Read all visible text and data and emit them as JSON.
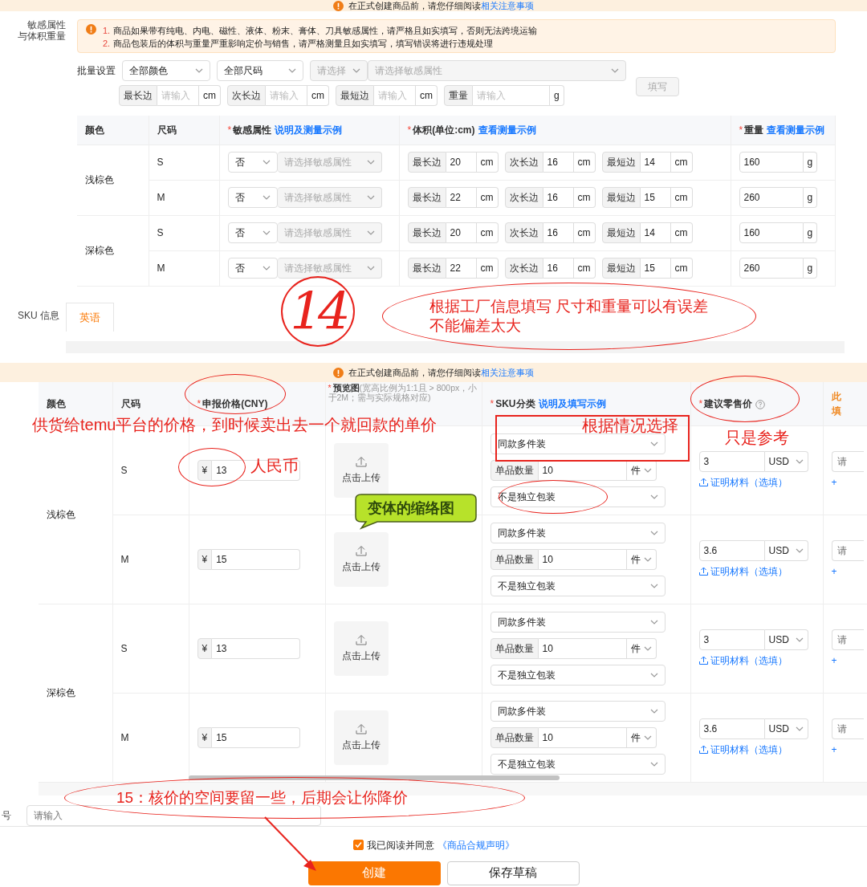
{
  "top_notice": {
    "text": "在正式创建商品前，请您仔细阅读",
    "link": "相关注意事项"
  },
  "spec_section": {
    "label_lines": [
      "敏感属性",
      "与体积重量"
    ],
    "warnings": [
      {
        "number": "1.",
        "text": "商品如果带有纯电、内电、磁性、液体、粉末、膏体、刀具敏感属性，请严格且如实填写，否则无法跨境运输"
      },
      {
        "number": "2.",
        "text": "商品包装后的体积与重量严重影响定价与销售，请严格测量且如实填写，填写错误将进行违规处理"
      }
    ],
    "batch": {
      "label": "批量设置",
      "selects": [
        {
          "text": "全部颜色",
          "disabled": false
        },
        {
          "text": "全部尺码",
          "disabled": false
        },
        {
          "text": "请选择",
          "disabled": true
        },
        {
          "text": "请选择敏感属性",
          "disabled": true
        }
      ],
      "fields": [
        {
          "label": "最长边",
          "placeholder": "请输入",
          "unit": "cm"
        },
        {
          "label": "次长边",
          "placeholder": "请输入",
          "unit": "cm"
        },
        {
          "label": "最短边",
          "placeholder": "请输入",
          "unit": "cm"
        },
        {
          "label": "重量",
          "placeholder": "请输入",
          "unit": "g"
        }
      ],
      "button": {
        "label": "填写",
        "disabled": true
      }
    },
    "table": {
      "columns": [
        {
          "label": "颜色"
        },
        {
          "label": "尺码"
        },
        {
          "mark": "*",
          "label": "敏感属性",
          "link": "说明及测量示例"
        },
        {
          "mark": "*",
          "label": "体积(单位:cm)",
          "link": "查看测量示例"
        },
        {
          "mark": "*",
          "label": "重量",
          "link": "查看测量示例"
        }
      ],
      "groups": [
        {
          "color_name": "浅棕色",
          "rows": [
            {
              "size": "S",
              "sensitive": "否",
              "sensitive_detail": "请选择敏感属性",
              "dims": [
                {
                  "label": "最长边",
                  "value": "20",
                  "unit": "cm"
                },
                {
                  "label": "次长边",
                  "value": "16",
                  "unit": "cm"
                },
                {
                  "label": "最短边",
                  "value": "14",
                  "unit": "cm"
                }
              ],
              "weight": "160",
              "weight_unit": "g"
            },
            {
              "size": "M",
              "sensitive": "否",
              "sensitive_detail": "请选择敏感属性",
              "dims": [
                {
                  "label": "最长边",
                  "value": "22",
                  "unit": "cm"
                },
                {
                  "label": "次长边",
                  "value": "16",
                  "unit": "cm"
                },
                {
                  "label": "最短边",
                  "value": "15",
                  "unit": "cm"
                }
              ],
              "weight": "260",
              "weight_unit": "g"
            }
          ]
        },
        {
          "color_name": "深棕色",
          "rows": [
            {
              "size": "S",
              "sensitive": "否",
              "sensitive_detail": "请选择敏感属性",
              "dims": [
                {
                  "label": "最长边",
                  "value": "20",
                  "unit": "cm"
                },
                {
                  "label": "次长边",
                  "value": "16",
                  "unit": "cm"
                },
                {
                  "label": "最短边",
                  "value": "14",
                  "unit": "cm"
                }
              ],
              "weight": "160",
              "weight_unit": "g"
            },
            {
              "size": "M",
              "sensitive": "否",
              "sensitive_detail": "请选择敏感属性",
              "dims": [
                {
                  "label": "最长边",
                  "value": "22",
                  "unit": "cm"
                },
                {
                  "label": "次长边",
                  "value": "16",
                  "unit": "cm"
                },
                {
                  "label": "最短边",
                  "value": "15",
                  "unit": "cm"
                }
              ],
              "weight": "260",
              "weight_unit": "g"
            }
          ]
        }
      ]
    }
  },
  "sku_info": {
    "label": "SKU 信息",
    "tabs": [
      {
        "label": "英语",
        "selected": true
      }
    ]
  },
  "second_notice": {
    "text": "在正式创建商品前，请您仔细阅读",
    "link": "相关注意事项"
  },
  "sku_table": {
    "columns": [
      {
        "label": "颜色"
      },
      {
        "label": "尺码"
      },
      {
        "mark": "*",
        "label": "申报价格(CNY)"
      },
      {
        "mark": "*",
        "label": "预览图",
        "hint": "(宽高比例为1:1且 > 800px，小于2M；需与实际规格对应)"
      },
      {
        "mark": "*",
        "label": "SKU分类",
        "link": "说明及填写示例"
      },
      {
        "mark": "*",
        "label": "建议零售价",
        "help": true
      },
      {
        "lines": [
          "此",
          "填"
        ]
      }
    ],
    "groups": [
      {
        "color_name": "浅棕色",
        "rows": [
          {
            "size": "S",
            "currency": "¥",
            "price": "13",
            "upload": "点击上传",
            "category": "同款多件装",
            "qty_label": "单品数量",
            "qty": "10",
            "qty_unit": "件",
            "packaging": "不是独立包装",
            "retail": "3",
            "retail_currency": "USD",
            "proof_link": "证明材料（选填）",
            "extra_placeholder": "请",
            "extra_link": "+"
          },
          {
            "size": "M",
            "currency": "¥",
            "price": "15",
            "upload": "点击上传",
            "category": "同款多件装",
            "qty_label": "单品数量",
            "qty": "10",
            "qty_unit": "件",
            "packaging": "不是独立包装",
            "retail": "3.6",
            "retail_currency": "USD",
            "proof_link": "证明材料（选填）",
            "extra_placeholder": "请",
            "extra_link": "+"
          }
        ]
      },
      {
        "color_name": "深棕色",
        "rows": [
          {
            "size": "S",
            "currency": "¥",
            "price": "13",
            "upload": "点击上传",
            "category": "同款多件装",
            "qty_label": "单品数量",
            "qty": "10",
            "qty_unit": "件",
            "packaging": "不是独立包装",
            "retail": "3",
            "retail_currency": "USD",
            "proof_link": "证明材料（选填）",
            "extra_placeholder": "请",
            "extra_link": "+"
          },
          {
            "size": "M",
            "currency": "¥",
            "price": "15",
            "upload": "点击上传",
            "category": "同款多件装",
            "qty_label": "单品数量",
            "qty": "10",
            "qty_unit": "件",
            "packaging": "不是独立包装",
            "retail": "3.6",
            "retail_currency": "USD",
            "proof_link": "证明材料（选填）",
            "extra_placeholder": "请",
            "extra_link": "+"
          }
        ]
      }
    ]
  },
  "item_no": {
    "label": "号",
    "placeholder": "请输入"
  },
  "agreement": {
    "checked": true,
    "text": "我已阅读并同意",
    "link": "《商品合规声明》"
  },
  "buttons": [
    {
      "label": "创建",
      "kind": "primary"
    },
    {
      "label": "保存草稿",
      "kind": "secondary"
    }
  ],
  "annotations": [
    {
      "kind": "handwriting",
      "text": "14"
    },
    {
      "kind": "ellipse_note",
      "lines": [
        "根据工厂信息填写 尺寸和重量可以有误差",
        "不能偏差太大"
      ]
    },
    {
      "kind": "plain_note",
      "text": "供货给temu平台的价格，到时候卖出去一个就回款的单价"
    },
    {
      "kind": "ellipse"
    },
    {
      "kind": "ellipse"
    },
    {
      "kind": "plain_note",
      "text": "人民币"
    },
    {
      "kind": "box_note",
      "text": "根据情况选择"
    },
    {
      "kind": "plain_note",
      "text": "只是参考"
    },
    {
      "kind": "ellipse"
    },
    {
      "kind": "ellipse"
    },
    {
      "kind": "bubble",
      "text": "变体的缩络图"
    },
    {
      "kind": "ellipse_note",
      "lines": [
        "15：核价的空间要留一些，后期会让你降价"
      ]
    },
    {
      "kind": "arrow"
    }
  ]
}
